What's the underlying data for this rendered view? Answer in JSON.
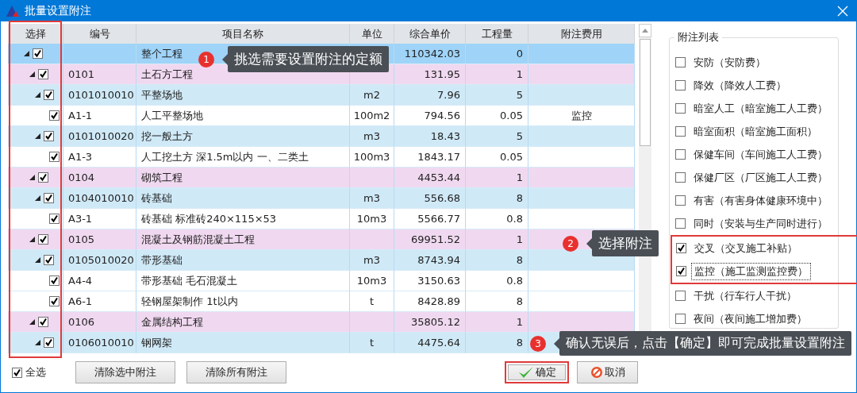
{
  "window": {
    "title": "批量设置附注"
  },
  "table": {
    "columns": [
      "选择",
      "编号",
      "项目名称",
      "单位",
      "综合单价",
      "工程量",
      "附注费用"
    ],
    "select_column_highlighted": true,
    "rows": [
      {
        "kind": "project",
        "selected": true,
        "checked": true,
        "expanded": true,
        "name": "整个工程",
        "price": "110342.03",
        "quantity": "0",
        "children": [
          {
            "kind": "division",
            "selected": false,
            "checked": true,
            "expanded": true,
            "code": "0101",
            "name": "土石方工程",
            "price": "131.95",
            "quantity": "1",
            "children": [
              {
                "kind": "item",
                "selected": false,
                "checked": true,
                "expanded": true,
                "code": "0101010010",
                "name": "平整场地",
                "unit": "m2",
                "price": "7.96",
                "quantity": "5",
                "children": [
                  {
                    "kind": "quota",
                    "selected": false,
                    "checked": true,
                    "code": "A1-1",
                    "name": "人工平整场地",
                    "unit": "100m2",
                    "price": "794.56",
                    "quantity": "0.05",
                    "fee": "监控"
                  }
                ]
              },
              {
                "kind": "item",
                "selected": false,
                "checked": true,
                "expanded": true,
                "code": "0101010020",
                "name": "挖一般土方",
                "unit": "m3",
                "price": "18.43",
                "quantity": "5",
                "children": [
                  {
                    "kind": "quota",
                    "selected": false,
                    "checked": true,
                    "code": "A1-3",
                    "name": "人工挖土方 深1.5m以内 一、二类土",
                    "unit": "100m3",
                    "price": "1843.17",
                    "quantity": "0.05"
                  }
                ]
              }
            ]
          },
          {
            "kind": "division",
            "selected": false,
            "checked": true,
            "expanded": true,
            "code": "0104",
            "name": "砌筑工程",
            "price": "4453.44",
            "quantity": "1",
            "children": [
              {
                "kind": "item",
                "selected": false,
                "checked": true,
                "expanded": true,
                "code": "0104010010",
                "name": "砖基础",
                "unit": "m3",
                "price": "556.68",
                "quantity": "8",
                "children": [
                  {
                    "kind": "quota",
                    "selected": false,
                    "checked": true,
                    "code": "A3-1",
                    "name": "砖基础 标准砖240×115×53",
                    "unit": "10m3",
                    "price": "5566.77",
                    "quantity": "0.8"
                  }
                ]
              }
            ]
          },
          {
            "kind": "division",
            "selected": false,
            "checked": true,
            "expanded": true,
            "code": "0105",
            "name": "混凝土及钢筋混凝土工程",
            "price": "69951.52",
            "quantity": "1",
            "children": [
              {
                "kind": "item",
                "selected": false,
                "checked": true,
                "expanded": true,
                "code": "0105010020",
                "name": "带形基础",
                "unit": "m3",
                "price": "8743.94",
                "quantity": "8",
                "children": [
                  {
                    "kind": "quota",
                    "selected": false,
                    "checked": true,
                    "code": "A4-4",
                    "name": "带形基础 毛石混凝土",
                    "unit": "10m3",
                    "price": "3150.63",
                    "quantity": "0.8"
                  },
                  {
                    "kind": "quota",
                    "selected": false,
                    "checked": true,
                    "code": "A6-1",
                    "name": "轻钢屋架制作 1t以内",
                    "unit": "t",
                    "price": "8428.89",
                    "quantity": "8"
                  }
                ]
              }
            ]
          },
          {
            "kind": "division",
            "selected": false,
            "checked": true,
            "expanded": true,
            "code": "0106",
            "name": "金属结构工程",
            "price": "35805.12",
            "quantity": "1",
            "children": [
              {
                "kind": "item",
                "selected": false,
                "checked": true,
                "expanded": true,
                "code": "0106010010",
                "name": "钢网架",
                "unit": "t",
                "price": "4475.64",
                "quantity": "8"
              }
            ]
          }
        ]
      }
    ]
  },
  "notes": {
    "title": "附注列表",
    "items": [
      {
        "label": "安防（安防费）",
        "checked": false,
        "highlighted": false,
        "focused": false
      },
      {
        "label": "降效（降效人工费）",
        "checked": false,
        "highlighted": false,
        "focused": false
      },
      {
        "label": "暗室人工（暗室施工人工费）",
        "checked": false,
        "highlighted": false,
        "focused": false
      },
      {
        "label": "暗室面积（暗室施工面积）",
        "checked": false,
        "highlighted": false,
        "focused": false
      },
      {
        "label": "保健车间（车间施工人工费）",
        "checked": false,
        "highlighted": false,
        "focused": false
      },
      {
        "label": "保健厂区（厂区施工人工费）",
        "checked": false,
        "highlighted": false,
        "focused": false
      },
      {
        "label": "有害（有害身体健康环境中）",
        "checked": false,
        "highlighted": false,
        "focused": false
      },
      {
        "label": "同时（安装与生产同时进行）",
        "checked": false,
        "highlighted": false,
        "focused": false
      },
      {
        "label": "交叉（交叉施工补贴）",
        "checked": true,
        "highlighted": true,
        "focused": false
      },
      {
        "label": "监控（施工监测监控费）",
        "checked": true,
        "highlighted": true,
        "focused": true
      },
      {
        "label": "干扰（行车行人干扰）",
        "checked": false,
        "highlighted": false,
        "focused": false
      },
      {
        "label": "夜间（夜间施工增加费）",
        "checked": false,
        "highlighted": false,
        "focused": false
      }
    ]
  },
  "footer": {
    "select_all": {
      "label": "全选",
      "checked": true
    },
    "buttons": [
      {
        "kind": "plain",
        "label": "清除选中附注",
        "highlighted": false
      },
      {
        "kind": "plain",
        "label": "清除所有附注",
        "highlighted": false
      },
      {
        "kind": "ok",
        "label": "确定",
        "highlighted": true
      },
      {
        "kind": "cancel",
        "label": "取消",
        "highlighted": false
      }
    ]
  },
  "callouts": [
    {
      "number": "1",
      "text": "挑选需要设置附注的定额"
    },
    {
      "number": "2",
      "text": "选择附注"
    },
    {
      "number": "3",
      "text": "确认无误后，点击【确定】即可完成批量设置附注"
    }
  ]
}
